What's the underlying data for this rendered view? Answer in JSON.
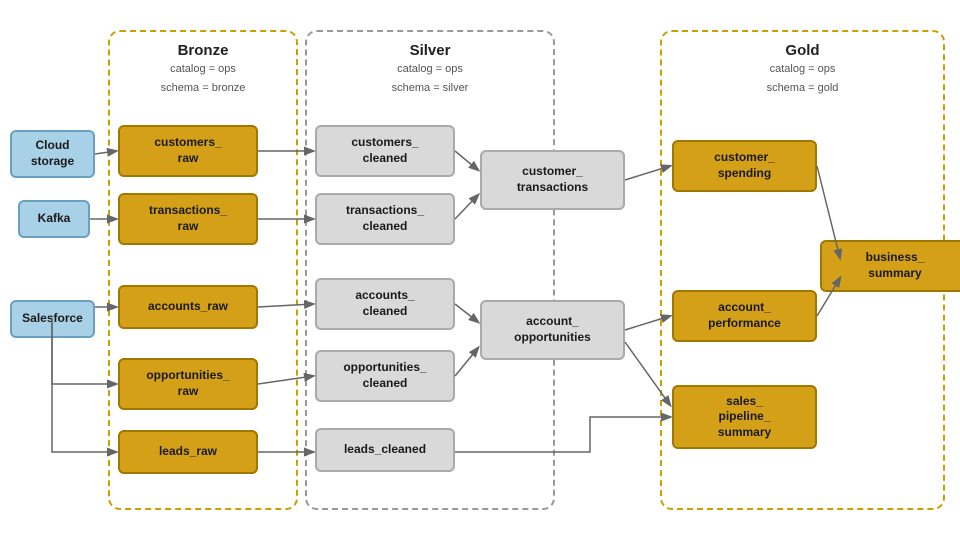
{
  "zones": {
    "bronze": {
      "title": "Bronze",
      "catalog": "catalog = ops",
      "schema": "schema = bronze"
    },
    "silver": {
      "title": "Silver",
      "catalog": "catalog = ops",
      "schema": "schema = silver"
    },
    "gold": {
      "title": "Gold",
      "catalog": "catalog = ops",
      "schema": "schema = gold"
    }
  },
  "sources": {
    "cloud_storage": "Cloud storage",
    "kafka": "Kafka",
    "salesforce": "Salesforce"
  },
  "bronze_nodes": {
    "customers_raw": "customers_\nraw",
    "transactions_raw": "transactions_\nraw",
    "accounts_raw": "accounts_raw",
    "opportunities_raw": "opportunities_\nraw",
    "leads_raw": "leads_raw"
  },
  "silver_nodes": {
    "customers_cleaned": "customers_\ncleaned",
    "transactions_cleaned": "transactions_\ncleaned",
    "customer_transactions": "customer_\ntransactions",
    "accounts_cleaned": "accounts_\ncleaned",
    "opportunities_cleaned": "opportunities_\ncleaned",
    "account_opportunities": "account_\nopportunities",
    "leads_cleaned": "leads_cleaned"
  },
  "gold_nodes": {
    "customer_spending": "customer_\nspending",
    "account_performance": "account_\nperformance",
    "sales_pipeline_summary": "sales_\npipeline_\nsummary",
    "business_summary": "business_\nsummary"
  }
}
